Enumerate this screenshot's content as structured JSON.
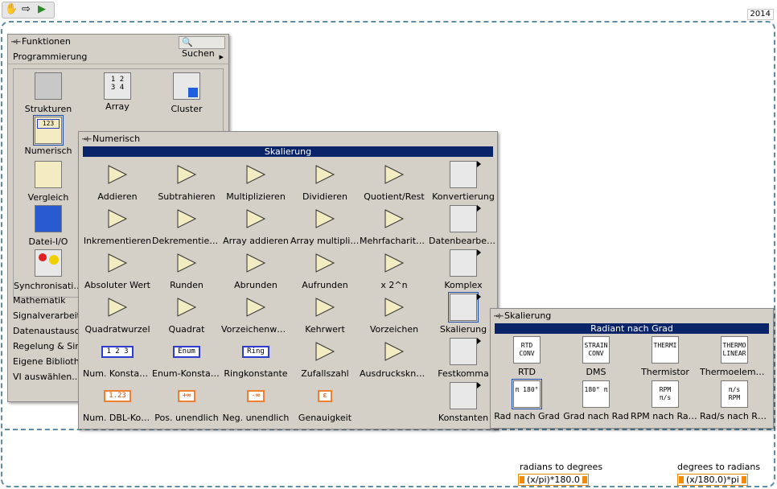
{
  "toolbar": {
    "hand_icon": "hand-icon",
    "arrow_icon": "arrow-right-icon",
    "run_icon": "run-icon"
  },
  "year_label": "2014",
  "functions_palette": {
    "title": "Funktionen",
    "search_label": "Suchen",
    "category": "Programmierung",
    "items": [
      "Strukturen",
      "Array",
      "Cluster",
      "Numerisch",
      "Vergleich",
      "Datei-I/O",
      "Synchronisation"
    ],
    "subcategories": [
      "Mathematik",
      "Signalverarbeitung",
      "Datenaustausch",
      "Regelung & Simulation",
      "Eigene Bibliotheken",
      "VI auswählen..."
    ]
  },
  "numeric_palette": {
    "title": "Numerisch",
    "banner": "Skalierung",
    "items": [
      "Addieren",
      "Subtrahieren",
      "Multiplizieren",
      "Dividieren",
      "Quotient/Rest",
      "Konvertierung",
      "Inkrementieren",
      "Dekrementieren",
      "Array addieren",
      "Array multiplizieren",
      "Mehrfacharithmetik",
      "Datenbearbeitung",
      "Absoluter Wert",
      "Runden",
      "Abrunden",
      "Aufrunden",
      "x 2^n",
      "Komplex",
      "Quadratwurzel",
      "Quadrat",
      "Vorzeichenwechsel",
      "Kehrwert",
      "Vorzeichen",
      "Skalierung",
      "Num. Konstante",
      "Enum-Konstante",
      "Ringkonstante",
      "Zufallszahl",
      "Ausdrucksknoten",
      "Festkomma",
      "Num. DBL-Konstante",
      "Pos. unendlich",
      "Neg. unendlich",
      "Genauigkeit",
      "",
      "Konstanten"
    ],
    "const_texts": [
      "1 2 3",
      "Enum",
      "Ring",
      "1.23",
      "+∞",
      "-∞",
      "ε"
    ]
  },
  "scaling_palette": {
    "title": "Skalierung",
    "banner": "Radiant nach Grad",
    "items": [
      "RTD",
      "DMS",
      "Thermistor",
      "Thermoelement",
      "Rad nach Grad",
      "Grad nach Rad",
      "RPM nach Rad/s",
      "Rad/s nach RPM"
    ],
    "icon_texts": [
      "RTD CONV",
      "STRAIN CONV",
      "THERMI",
      "THERMO LINEAR",
      "π 180°",
      "180° π",
      "RPM π/s",
      "π/s RPM"
    ]
  },
  "block_diagram": {
    "label1": "radians to degrees",
    "node1": "(x/pi)*180.0",
    "label2": "degrees to radians",
    "node2": "(x/180.0)*pi"
  },
  "colors": {
    "accent": "#0a246a",
    "palette_bg": "#d4d0c8",
    "dash": "#5f8da6",
    "node": "#e48c12"
  }
}
